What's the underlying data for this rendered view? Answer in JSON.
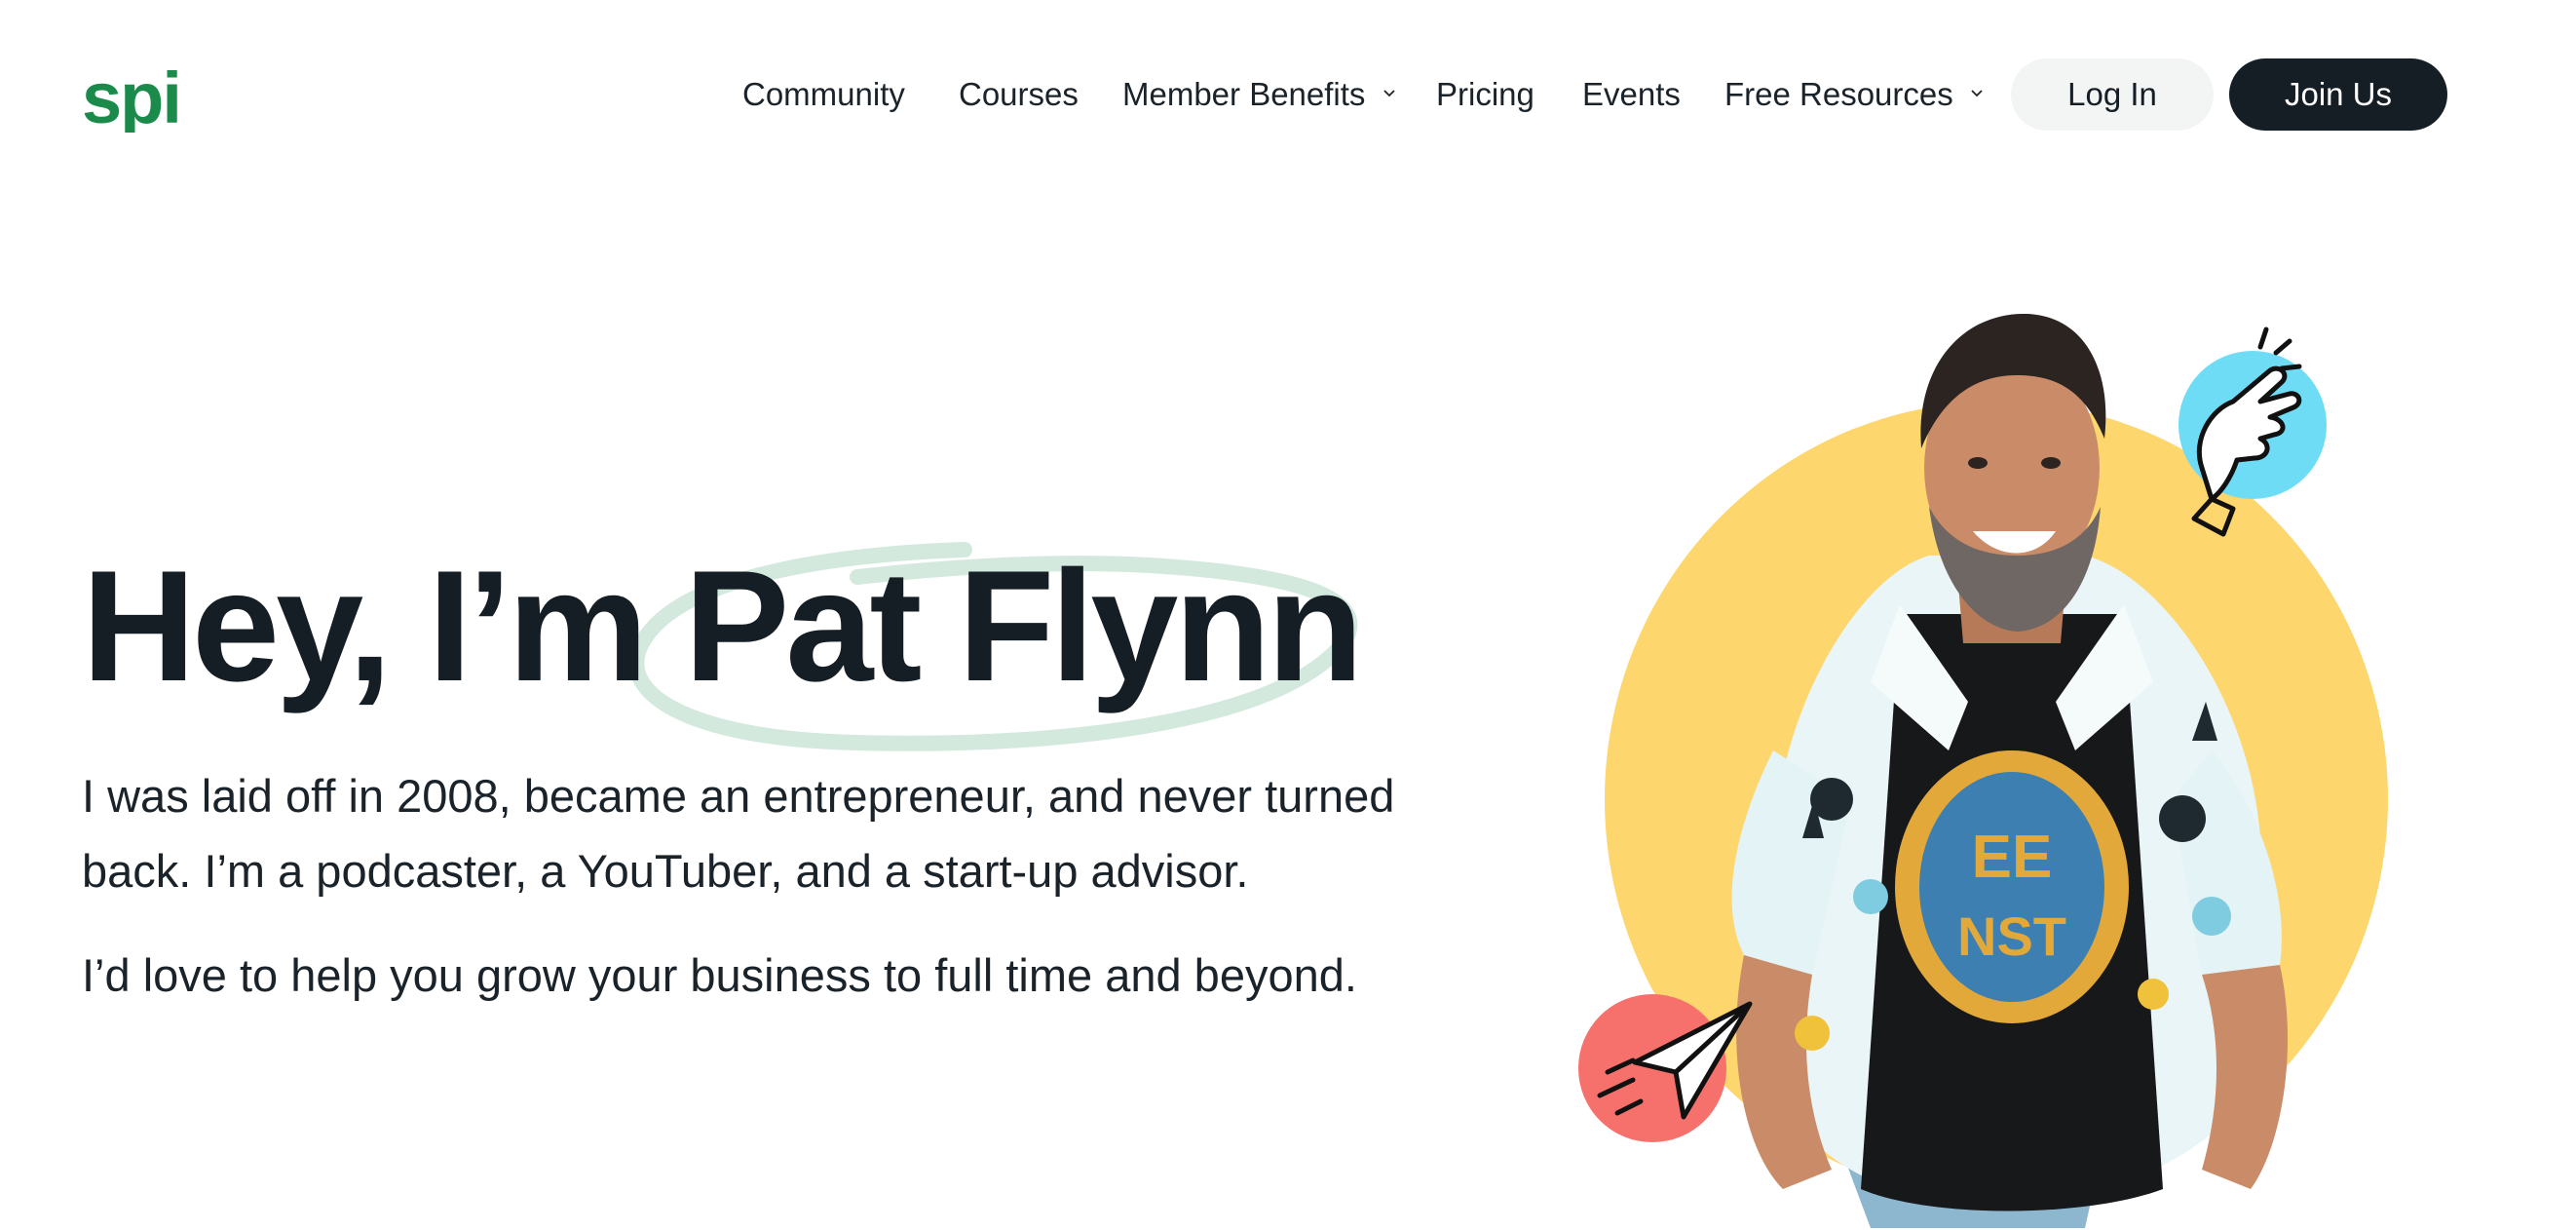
{
  "brand": {
    "logo_text": "spi",
    "logo_color": "#1a8b4a"
  },
  "nav": {
    "items": [
      {
        "label": "Community",
        "has_dropdown": false
      },
      {
        "label": "Courses",
        "has_dropdown": false
      },
      {
        "label": "Member Benefits",
        "has_dropdown": true
      },
      {
        "label": "Pricing",
        "has_dropdown": false
      },
      {
        "label": "Events",
        "has_dropdown": false
      },
      {
        "label": "Free Resources",
        "has_dropdown": true
      }
    ],
    "login_label": "Log In",
    "join_label": "Join Us"
  },
  "hero": {
    "title": "Hey, I’m Pat Flynn",
    "paragraph_1": "I was laid off in 2008, became an entrepreneur, and never turned back. I’m a podcaster, a YouTuber, and a start-up advisor.",
    "paragraph_2": "I’d love to help you grow your business to full time and beyond."
  },
  "colors": {
    "text": "#161e25",
    "swoosh": "#d4e9de",
    "yellow_circle": "#fdd66e",
    "blue_circle": "#6fdcf6",
    "red_circle": "#f6716c",
    "join_button": "#161e25",
    "login_button": "#f3f4f4"
  },
  "icons": {
    "top_badge": "finger-snap-icon",
    "bottom_badge": "paper-plane-icon"
  }
}
